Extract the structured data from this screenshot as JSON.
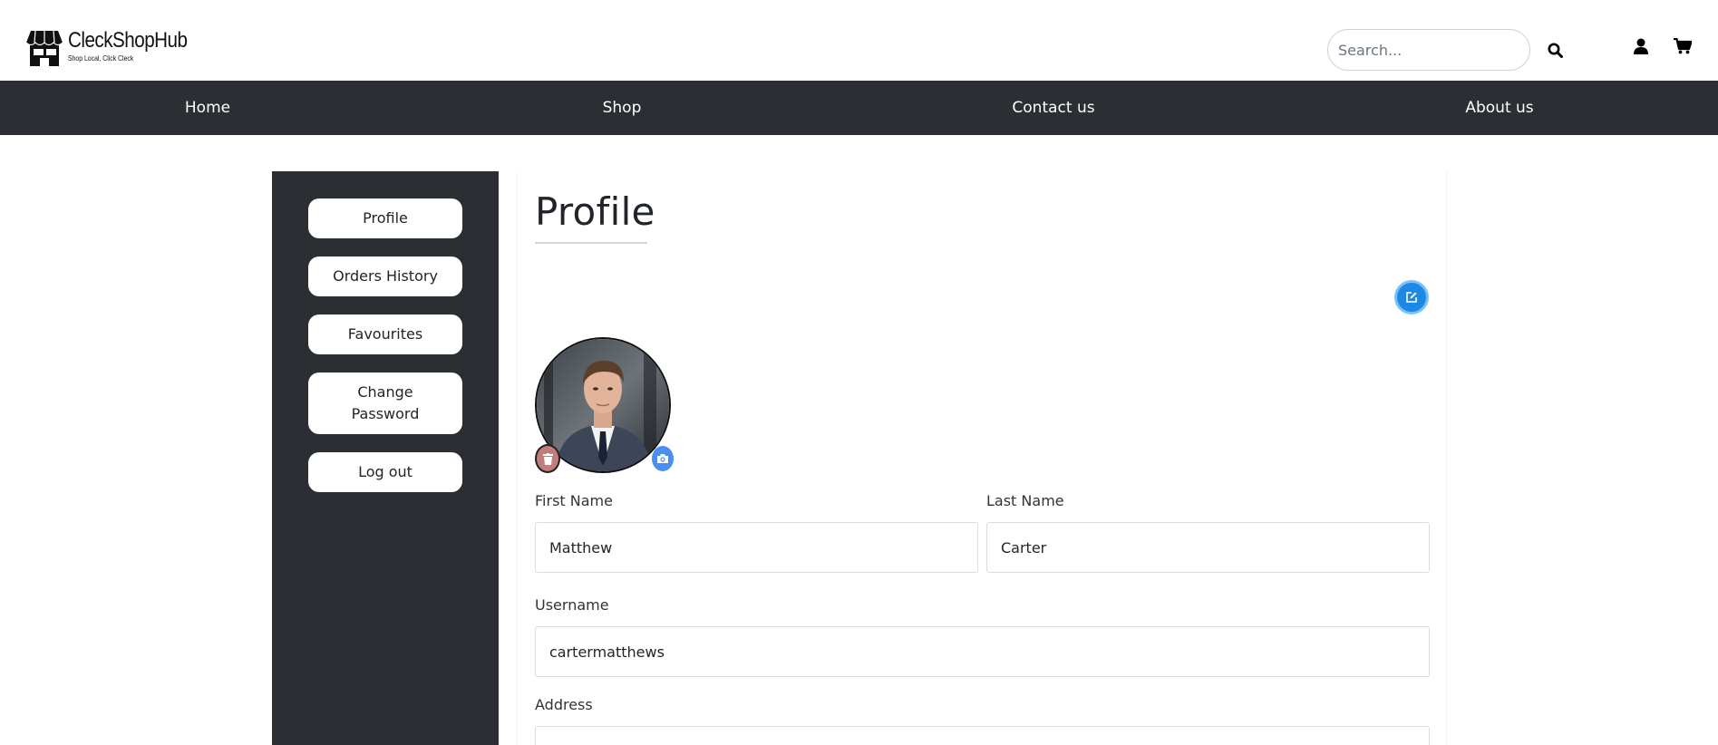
{
  "brand": {
    "name": "CleckShopHub",
    "tagline": "Shop Local, Click Cleck"
  },
  "search": {
    "placeholder": "Search..."
  },
  "header_icons": [
    "search-icon",
    "user-icon",
    "cart-icon"
  ],
  "nav": {
    "items": [
      "Home",
      "Shop",
      "Contact us",
      "About us"
    ]
  },
  "sidebar": {
    "items": [
      "Profile",
      "Orders History",
      "Favourites",
      "Change Password",
      "Log out"
    ]
  },
  "profile": {
    "title": "Profile",
    "first_name_label": "First Name",
    "first_name": "Matthew",
    "last_name_label": "Last Name",
    "last_name": "Carter",
    "username_label": "Username",
    "username": "cartermatthews",
    "address_label": "Address",
    "address": ""
  },
  "colors": {
    "nav_bg": "#2b2e32",
    "accent": "#1e88e5",
    "delete": "#c17c7c",
    "camera": "#4a8ff0"
  }
}
